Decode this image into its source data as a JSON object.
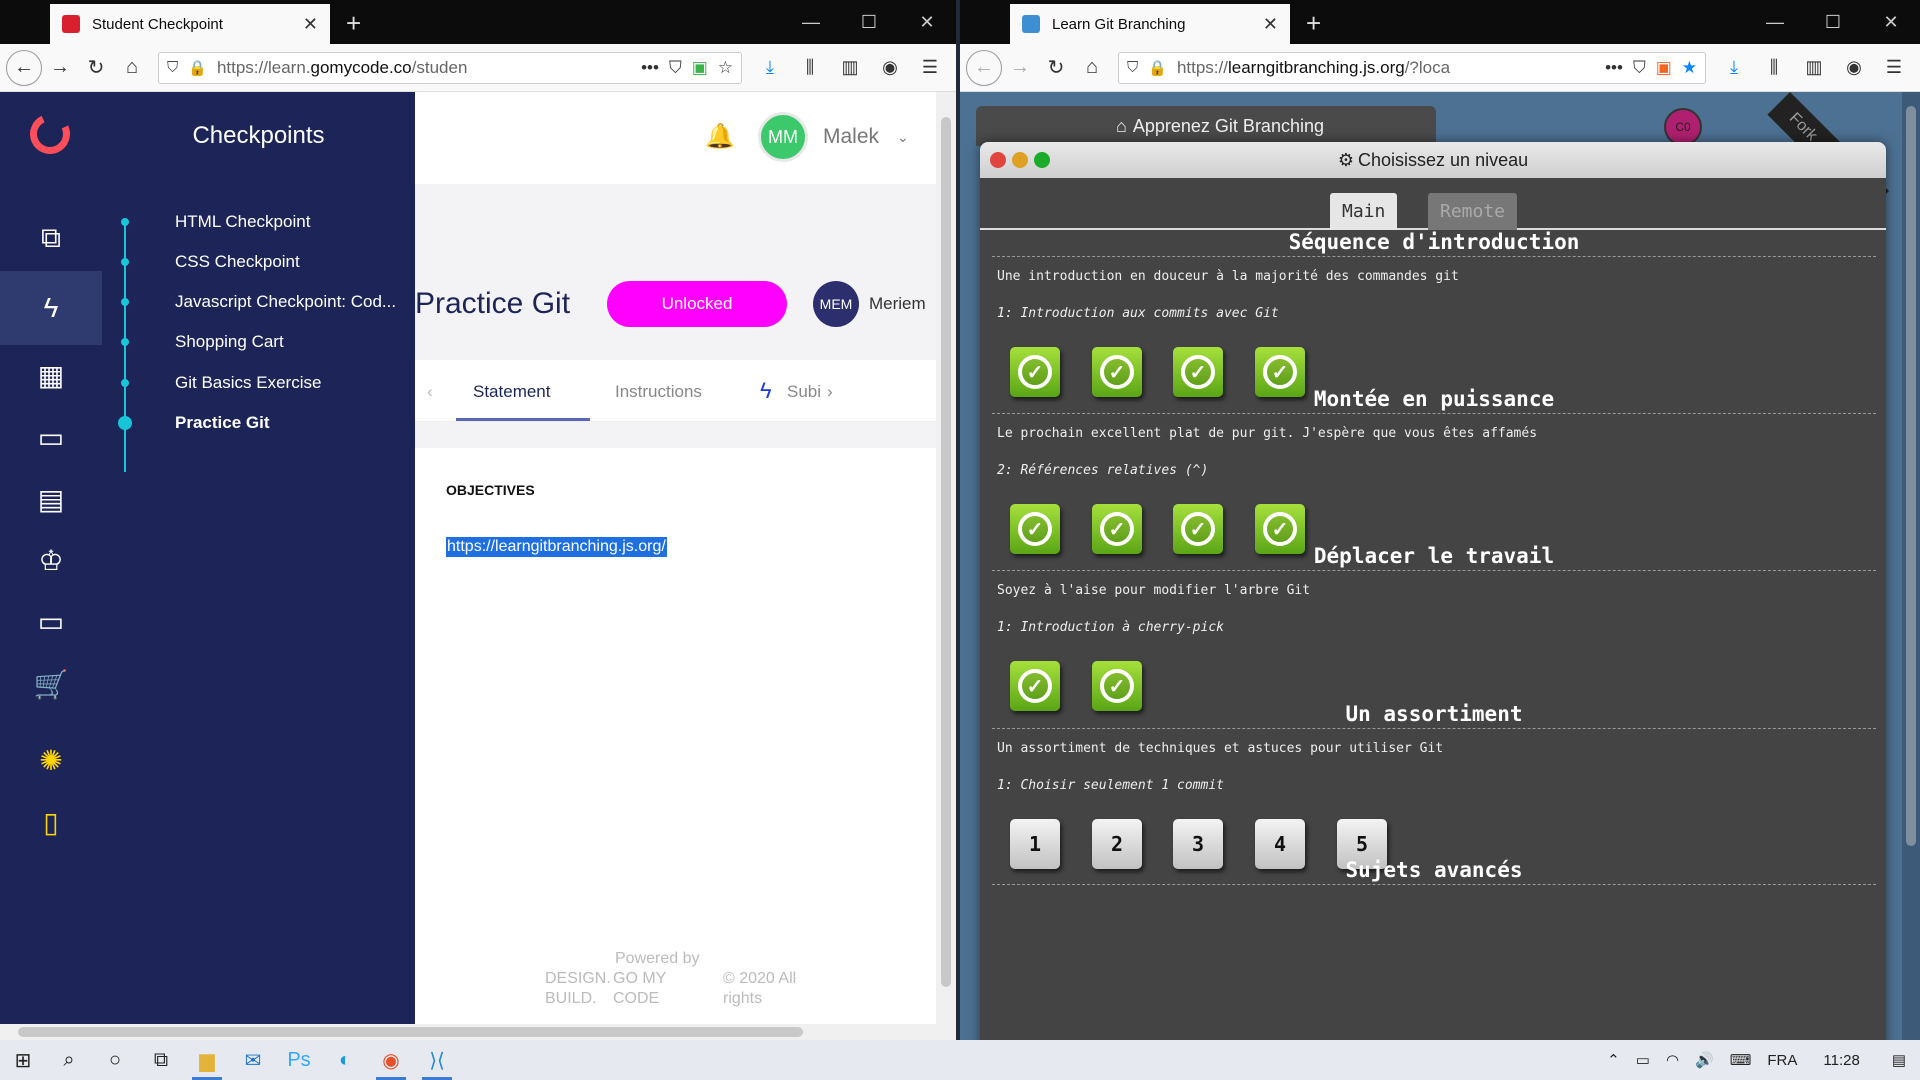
{
  "left_browser": {
    "tab_title": "Student Checkpoint",
    "url_prefix": "https://learn.",
    "url_domain": "gomycode.co",
    "url_suffix": "/studen",
    "app": {
      "sidebar_title": "Checkpoints",
      "checkpoints": [
        {
          "label": "HTML Checkpoint"
        },
        {
          "label": "CSS Checkpoint"
        },
        {
          "label": "Javascript Checkpoint: Cod..."
        },
        {
          "label": "Shopping Cart"
        },
        {
          "label": "Git Basics Exercise"
        },
        {
          "label": "Practice Git"
        }
      ],
      "user_initials": "MM",
      "user_name": "Malek",
      "page_title": "Practice Git",
      "status_badge": "Unlocked",
      "mentor_initials": "MEM",
      "mentor_name": "Meriem",
      "tabs": [
        "Statement",
        "Instructions",
        "Subi"
      ],
      "objectives_heading": "OBJECTIVES",
      "objective_link": "https://learngitbranching.js.org/",
      "footer": {
        "powered_by": "Powered by",
        "col1_line1": "DESIGN.",
        "col1_line2": "BUILD.",
        "col2_line1": "GO MY",
        "col2_line2": "CODE",
        "col3_line1": "© 2020 All",
        "col3_line2": "rights"
      }
    }
  },
  "right_browser": {
    "tab_title": "Learn Git Branching",
    "url_prefix": "https://",
    "url_domain": "learngitbranching.js.org",
    "url_suffix": "/?loca",
    "app": {
      "bg_window_title": "Apprenez Git Branching",
      "avatar": "C0",
      "fork_text": "Fork",
      "dialog_title": "Choisissez un niveau",
      "tabs": [
        "Main",
        "Remote"
      ],
      "sections": [
        {
          "title": "Séquence d'introduction",
          "description": "Une introduction en douceur à la majorité des commandes git",
          "subtitle": "1: Introduction aux commits avec Git",
          "levels": [
            "done",
            "done",
            "done",
            "done"
          ]
        },
        {
          "title": "Montée en puissance",
          "description": "Le prochain excellent plat de pur git. J'espère que vous êtes affamés",
          "subtitle": "2: Références relatives (^)",
          "levels": [
            "done",
            "done",
            "done",
            "done"
          ]
        },
        {
          "title": "Déplacer le travail",
          "description": "Soyez à l'aise pour modifier l'arbre Git",
          "subtitle": "1: Introduction à cherry-pick",
          "levels": [
            "done",
            "done"
          ]
        },
        {
          "title": "Un assortiment",
          "description": "Un assortiment de techniques et astuces pour utiliser Git",
          "subtitle": "1: Choisir seulement 1 commit",
          "levels": [
            "1",
            "2",
            "3",
            "4",
            "5"
          ]
        },
        {
          "title": "Sujets avancés"
        }
      ]
    }
  },
  "taskbar": {
    "language": "FRA",
    "time": "11:28"
  },
  "colors": {
    "sidebar": "#1d2558",
    "accent_cyan": "#18c5d7",
    "badge_magenta": "#ff00ff",
    "level_done_green": "#5aa516"
  }
}
